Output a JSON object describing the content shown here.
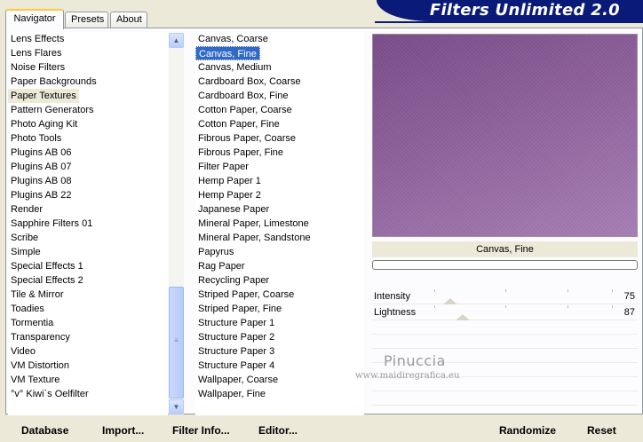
{
  "tabs": [
    "Navigator",
    "Presets",
    "About"
  ],
  "banner_title": "Filters Unlimited 2.0",
  "categories": [
    "Lens Effects",
    "Lens Flares",
    "Noise Filters",
    "Paper Backgrounds",
    "Paper Textures",
    "Pattern Generators",
    "Photo Aging Kit",
    "Photo Tools",
    "Plugins AB 06",
    "Plugins AB 07",
    "Plugins AB 08",
    "Plugins AB 22",
    "Render",
    "Sapphire Filters 01",
    "Scribe",
    "Simple",
    "Special Effects 1",
    "Special Effects 2",
    "Tile & Mirror",
    "Toadies",
    "Tormentia",
    "Transparency",
    "Video",
    "VM Distortion",
    "VM Texture",
    "°v° Kiwi`s Oelfilter"
  ],
  "selected_category": "Paper Textures",
  "filters": [
    "Canvas, Coarse",
    "Canvas, Fine",
    "Canvas, Medium",
    "Cardboard Box, Coarse",
    "Cardboard Box, Fine",
    "Cotton Paper, Coarse",
    "Cotton Paper, Fine",
    "Fibrous Paper, Coarse",
    "Fibrous Paper, Fine",
    "Filter Paper",
    "Hemp Paper 1",
    "Hemp Paper 2",
    "Japanese Paper",
    "Mineral Paper, Limestone",
    "Mineral Paper, Sandstone",
    "Papyrus",
    "Rag Paper",
    "Recycling Paper",
    "Striped Paper, Coarse",
    "Striped Paper, Fine",
    "Structure Paper 1",
    "Structure Paper 2",
    "Structure Paper 3",
    "Structure Paper 4",
    "Wallpaper, Coarse",
    "Wallpaper, Fine"
  ],
  "selected_filter": "Canvas, Fine",
  "preview": {
    "filter_name": "Canvas, Fine",
    "color": "#8a5c98"
  },
  "params": [
    {
      "label": "Intensity",
      "value": "75",
      "level": 75
    },
    {
      "label": "Lightness",
      "value": "87",
      "level": 87
    }
  ],
  "watermark": {
    "line1": "Pinuccia",
    "line2": "www.maidiregrafica.eu"
  },
  "buttons": {
    "database": "Database",
    "import": "Import...",
    "filter_info": "Filter Info...",
    "editor": "Editor...",
    "randomize": "Randomize",
    "reset": "Reset"
  },
  "icons": {
    "scroll_up": "chevron-up-icon",
    "scroll_down": "chevron-down-icon",
    "grip": "grip-icon"
  }
}
